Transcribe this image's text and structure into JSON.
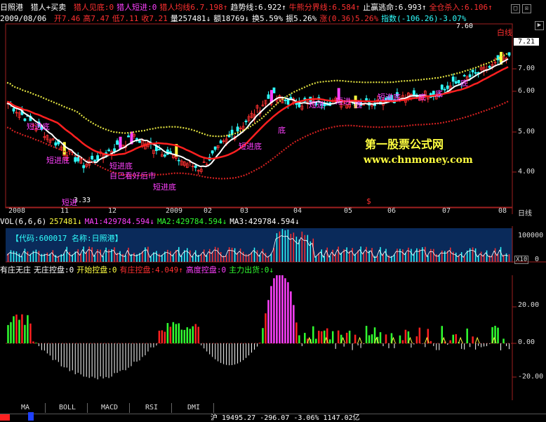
{
  "header1": {
    "stock": "日照港",
    "formula": "猎人+买卖",
    "items": [
      {
        "text": "猎人见底:0",
        "color": "#ff3030"
      },
      {
        "text": "猎人短进:0",
        "color": "#ff40ff"
      },
      {
        "text": "猎人均线6.7.198↑",
        "color": "#ff3030"
      },
      {
        "text": "趋势线:6.922↑",
        "color": "#ffffff"
      },
      {
        "text": "牛熊分界线:6.584↑",
        "color": "#ff3030"
      },
      {
        "text": "止赢逃命:6.993↑",
        "color": "#ffffff"
      },
      {
        "text": "全仓杀入:6.106↑",
        "color": "#ff3030"
      }
    ]
  },
  "header2": {
    "date": "2009/08/06",
    "items": [
      {
        "text": "开7.46",
        "color": "#ff3030"
      },
      {
        "text": "高7.47",
        "color": "#ff3030"
      },
      {
        "text": "低7.11",
        "color": "#ff3030"
      },
      {
        "text": "收7.21",
        "color": "#ff3030"
      },
      {
        "text": "量257481↓",
        "color": "#ffffff"
      },
      {
        "text": "额18769↓",
        "color": "#ffffff"
      },
      {
        "text": "换5.59%",
        "color": "#ffffff"
      },
      {
        "text": "振5.26%",
        "color": "#ffffff"
      },
      {
        "text": "涨(0.36)5.26%",
        "color": "#ff3030"
      },
      {
        "text": "指数(-106.26)-3.07%",
        "color": "#30ffff"
      }
    ]
  },
  "main_axis": {
    "ticks": [
      "7.00",
      "6.00",
      "5.00",
      "4.00"
    ],
    "price_tag": "7.21",
    "high_label": "7.60",
    "low_label": "3.33"
  },
  "annotations": [
    {
      "text": "短进底",
      "color": "#ff40ff"
    },
    {
      "text": "短进底",
      "color": "#ff40ff"
    },
    {
      "text": "短进",
      "color": "#ff40ff"
    },
    {
      "text": "短进底",
      "color": "#ff40ff"
    },
    {
      "text": "自己看好后市",
      "color": "#ff40ff"
    },
    {
      "text": "短进底",
      "color": "#ff40ff"
    },
    {
      "text": "短进底",
      "color": "#ff40ff"
    },
    {
      "text": "底",
      "color": "#ff40ff"
    },
    {
      "text": "短进",
      "color": "#ff40ff"
    },
    {
      "text": "底",
      "color": "#ff40ff"
    },
    {
      "text": "短进",
      "color": "#ff40ff"
    },
    {
      "text": "底",
      "color": "#ff40ff"
    },
    {
      "text": "短进底",
      "color": "#ff40ff"
    },
    {
      "text": "底",
      "color": "#ff40ff"
    },
    {
      "text": "底",
      "color": "#ff40ff"
    },
    {
      "text": "白线",
      "color": "#ff3030"
    },
    {
      "text": "$",
      "color": "#ff3030"
    }
  ],
  "watermark": {
    "title": "第一股票公式网",
    "url": "www.chnmoney.com"
  },
  "date_axis": [
    "2008",
    "11",
    "12",
    "2009",
    "02",
    "03",
    "04",
    "05",
    "06",
    "07",
    "08",
    "日线"
  ],
  "vol_header": {
    "items": [
      {
        "text": "VOL(6,6,6)",
        "color": "#ffffff"
      },
      {
        "text": "257481↓",
        "color": "#ffff40"
      },
      {
        "text": "MA1:429784.594↓",
        "color": "#ff40ff"
      },
      {
        "text": "MA2:429784.594↓",
        "color": "#30ff30"
      },
      {
        "text": "MA3:429784.594↓",
        "color": "#ffffff"
      }
    ]
  },
  "vol_info": "【代码:600017 名称:日照港】",
  "vol_axis": {
    "top": "100000",
    "unit": "X10",
    "zero": "0"
  },
  "ind_header": {
    "items": [
      {
        "text": "有庄无庄",
        "color": "#ffffff"
      },
      {
        "text": "无庄控盘:0",
        "color": "#ffffff"
      },
      {
        "text": "开始控盘:0",
        "color": "#ffff40"
      },
      {
        "text": "有庄控盘:4.049↑",
        "color": "#ff3030"
      },
      {
        "text": "高度控盘:0",
        "color": "#ff40ff"
      },
      {
        "text": "主力出货:0↓",
        "color": "#30ff30"
      }
    ]
  },
  "ind_axis": [
    "20.00",
    "0.00",
    "-20.00"
  ],
  "tabs": [
    "MA",
    "BOLL",
    "MACD",
    "RSI",
    "DMI"
  ],
  "status": "沪 19495.27  -296.07  -3.06%  1147.02亿"
}
